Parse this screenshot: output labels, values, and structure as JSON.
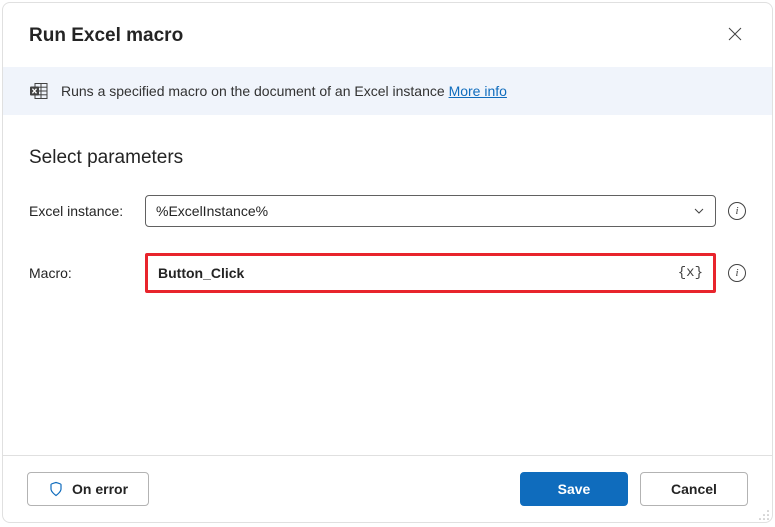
{
  "dialog": {
    "title": "Run Excel macro"
  },
  "infoBar": {
    "text": "Runs a specified macro on the document of an Excel instance ",
    "moreInfo": "More info"
  },
  "section": {
    "title": "Select parameters"
  },
  "fields": {
    "excelInstance": {
      "label": "Excel instance:",
      "value": "%ExcelInstance%"
    },
    "macro": {
      "label": "Macro:",
      "value": "Button_Click",
      "varIcon": "{x}"
    }
  },
  "footer": {
    "onError": "On error",
    "save": "Save",
    "cancel": "Cancel"
  }
}
